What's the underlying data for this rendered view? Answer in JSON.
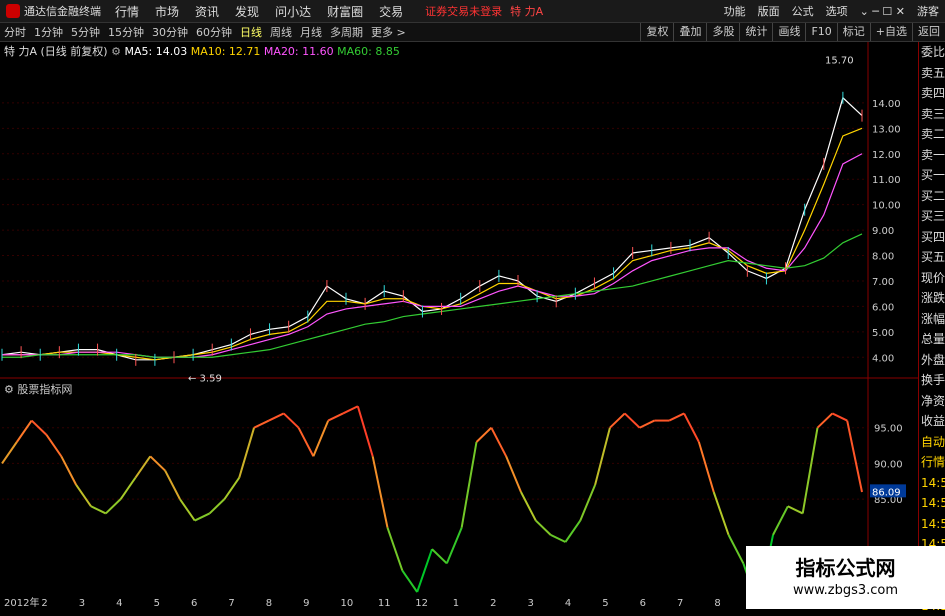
{
  "menubar": {
    "logo_text": "通达信金融终端",
    "menus": [
      "行情",
      "市场",
      "资讯",
      "发现",
      "问小达",
      "财富圈",
      "交易"
    ],
    "login_warning": "证券交易未登录",
    "stock_name": "特 力A",
    "right_items": [
      "功能",
      "版面",
      "公式",
      "选项",
      "游客"
    ]
  },
  "periodbar": {
    "periods": [
      "分时",
      "1分钟",
      "5分钟",
      "15分钟",
      "30分钟",
      "60分钟",
      "日线",
      "周线",
      "月线",
      "多周期",
      "更多 >"
    ],
    "active_index": 6,
    "right_buttons": [
      "复权",
      "叠加",
      "多股",
      "统计",
      "画线",
      "F10",
      "标记",
      "+自选",
      "返回"
    ]
  },
  "info": {
    "title": "特 力A (日线 前复权)",
    "ma": [
      {
        "label": "MA5: 14.03",
        "color": "#ffffff"
      },
      {
        "label": "MA10: 12.71",
        "color": "#ffd400"
      },
      {
        "label": "MA20: 11.60",
        "color": "#ff55ff"
      },
      {
        "label": "MA60: 8.85",
        "color": "#33cc33"
      }
    ]
  },
  "indicator": {
    "title": "股票指标网",
    "current_value": "86.09"
  },
  "right_panel": [
    "委比",
    "卖五",
    "卖四",
    "卖三",
    "卖二",
    "卖一",
    "买一",
    "买二",
    "买三",
    "买四",
    "买五",
    "现价",
    "涨跌",
    "涨幅",
    "总量",
    "外盘",
    "换手",
    "净资",
    "收益",
    "自动",
    "行情",
    "14:50",
    "14:50",
    "14:50",
    "14:50",
    "14:50",
    "14:50",
    "14:50"
  ],
  "watermark": {
    "text": "指标公式网",
    "url": "www.zbgs3.com"
  },
  "chart_data": [
    {
      "type": "line",
      "title": "特 力A (日线 前复权)",
      "ylim": [
        3.5,
        16
      ],
      "yticks": [
        "4.00",
        "5.00",
        "6.00",
        "7.00",
        "8.00",
        "9.00",
        "10.00",
        "11.00",
        "12.00",
        "13.00",
        "14.00"
      ],
      "annotations": [
        "15.70",
        "3.59"
      ],
      "series": [
        {
          "name": "MA5",
          "values": [
            4.1,
            4.2,
            4.1,
            4.2,
            4.3,
            4.3,
            4.1,
            3.9,
            3.9,
            4.0,
            4.1,
            4.3,
            4.5,
            4.9,
            5.1,
            5.2,
            5.6,
            6.8,
            6.3,
            6.1,
            6.6,
            6.4,
            5.8,
            5.9,
            6.3,
            6.8,
            7.2,
            7.0,
            6.4,
            6.2,
            6.5,
            6.9,
            7.3,
            8.1,
            8.2,
            8.3,
            8.4,
            8.7,
            8.1,
            7.4,
            7.1,
            7.5,
            9.8,
            11.6,
            14.2,
            13.5
          ]
        },
        {
          "name": "MA10",
          "values": [
            4.1,
            4.1,
            4.1,
            4.2,
            4.2,
            4.2,
            4.1,
            4.0,
            3.9,
            4.0,
            4.1,
            4.2,
            4.4,
            4.7,
            4.9,
            5.0,
            5.4,
            6.2,
            6.2,
            6.1,
            6.3,
            6.3,
            6.0,
            5.9,
            6.1,
            6.5,
            6.9,
            6.9,
            6.6,
            6.3,
            6.4,
            6.7,
            7.1,
            7.8,
            8.0,
            8.2,
            8.3,
            8.5,
            8.2,
            7.6,
            7.3,
            7.4,
            9.0,
            10.8,
            12.7,
            13.0
          ]
        },
        {
          "name": "MA20",
          "values": [
            4.1,
            4.1,
            4.1,
            4.1,
            4.2,
            4.2,
            4.2,
            4.1,
            4.0,
            4.0,
            4.0,
            4.1,
            4.3,
            4.5,
            4.7,
            4.9,
            5.2,
            5.7,
            5.9,
            6.0,
            6.1,
            6.2,
            6.0,
            6.0,
            6.0,
            6.3,
            6.6,
            6.8,
            6.6,
            6.4,
            6.4,
            6.5,
            6.9,
            7.4,
            7.8,
            8.0,
            8.2,
            8.3,
            8.3,
            7.8,
            7.5,
            7.4,
            8.3,
            9.6,
            11.6,
            12.0
          ]
        },
        {
          "name": "MA60",
          "values": [
            4.0,
            4.0,
            4.1,
            4.1,
            4.1,
            4.1,
            4.1,
            4.1,
            4.0,
            4.0,
            4.0,
            4.0,
            4.1,
            4.2,
            4.3,
            4.5,
            4.7,
            4.9,
            5.1,
            5.3,
            5.4,
            5.6,
            5.7,
            5.8,
            5.9,
            6.0,
            6.1,
            6.2,
            6.3,
            6.4,
            6.5,
            6.6,
            6.7,
            6.8,
            7.0,
            7.2,
            7.4,
            7.6,
            7.8,
            7.7,
            7.6,
            7.5,
            7.6,
            7.9,
            8.5,
            8.85
          ]
        }
      ]
    },
    {
      "type": "line",
      "title": "股票指标网",
      "ylim": [
        72,
        100
      ],
      "yticks": [
        "85.00",
        "90.00",
        "95.00"
      ],
      "current": 86.09,
      "xlabels": [
        "2012年",
        "2",
        "3",
        "4",
        "5",
        "6",
        "7",
        "8",
        "9",
        "10",
        "11",
        "12",
        "1",
        "2",
        "3",
        "4",
        "5",
        "6",
        "7",
        "8",
        "9",
        "10",
        "11",
        "1"
      ],
      "series": [
        {
          "name": "指标",
          "values": [
            90,
            93,
            96,
            94,
            91,
            87,
            84,
            83,
            85,
            88,
            91,
            89,
            85,
            82,
            83,
            85,
            88,
            95,
            96,
            97,
            95,
            91,
            96,
            97,
            98,
            91,
            81,
            75,
            72,
            78,
            76,
            81,
            93,
            95,
            91,
            86,
            82,
            80,
            79,
            82,
            87,
            95,
            97,
            95,
            96,
            96,
            97,
            93,
            86,
            80,
            76,
            70,
            80,
            84,
            83,
            95,
            97,
            96,
            86
          ]
        }
      ]
    }
  ]
}
